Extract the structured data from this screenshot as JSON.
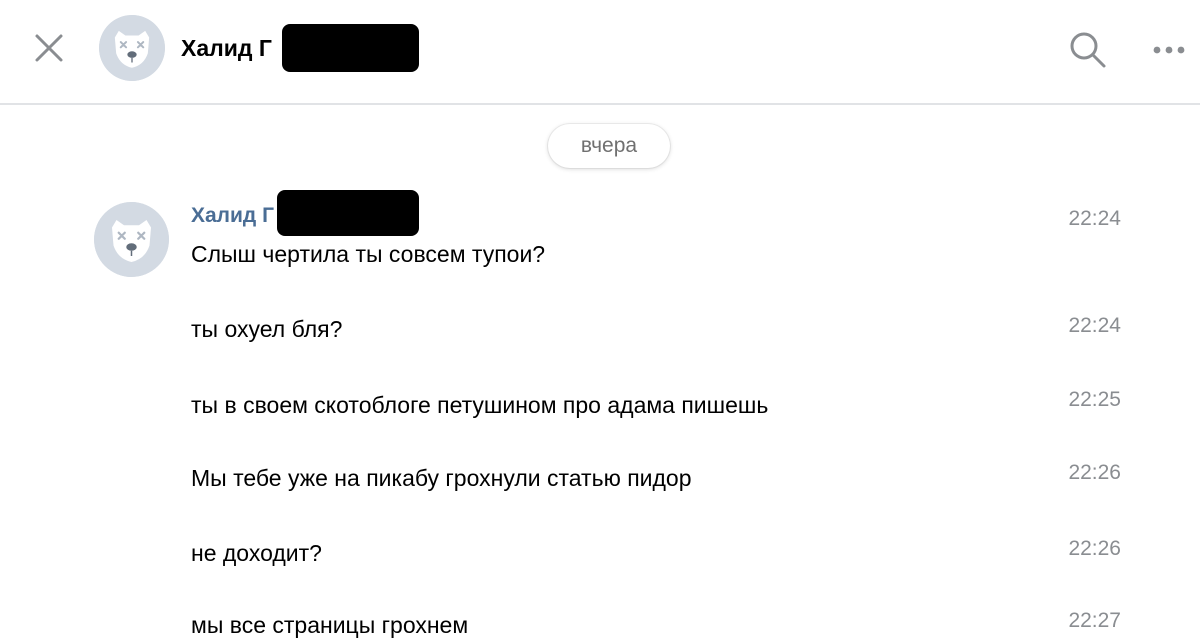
{
  "header": {
    "contact_name": "Халид Г",
    "actions": {
      "close_icon": "close-icon",
      "search_icon": "search-icon",
      "more_icon": "more-icon"
    }
  },
  "chat": {
    "date_separator": "вчера",
    "sender_name": "Халид Г",
    "messages": [
      {
        "text": "Слыш чертила ты совсем тупои?",
        "time": "22:24"
      },
      {
        "text": "ты охуел бля?",
        "time": "22:24"
      },
      {
        "text": "ты в своем скотоблоге петушином про адама пишешь",
        "time": "22:25"
      },
      {
        "text": "Мы тебе уже на пикабу грохнули статью пидор",
        "time": "22:26"
      },
      {
        "text": "не доходит?",
        "time": "22:26"
      },
      {
        "text": "мы все страницы грохнем",
        "time": "22:27"
      }
    ]
  },
  "colors": {
    "accent": "#4a6d95",
    "time": "#8a8d91",
    "divider": "#e1e3e6",
    "avatar_bg": "#d3dae3"
  }
}
